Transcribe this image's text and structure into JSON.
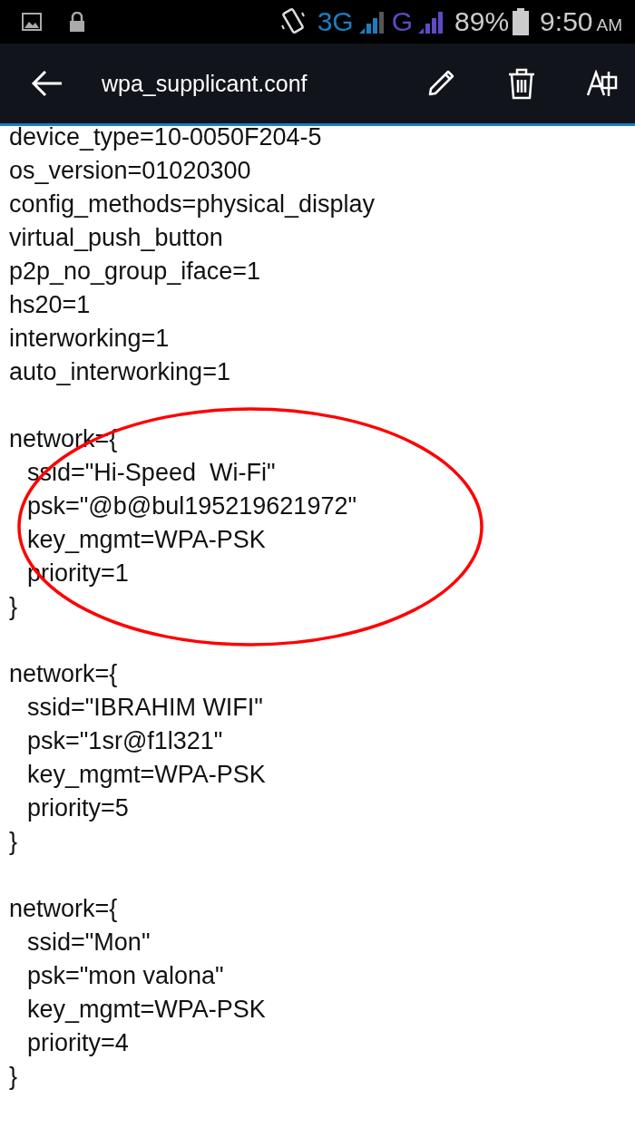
{
  "status_bar": {
    "network_1": "3G",
    "network_2": "G",
    "battery": "89%",
    "time": "9:50",
    "meridiem": "AM"
  },
  "app_bar": {
    "title": "wpa_supplicant.conf"
  },
  "settings_lines": [
    "device_type=10-0050F204-5",
    "os_version=01020300",
    "config_methods=physical_display",
    "virtual_push_button",
    "p2p_no_group_iface=1",
    "hs20=1",
    "interworking=1",
    "auto_interworking=1"
  ],
  "networks": [
    {
      "opening": "network={",
      "entries": [
        "ssid=\"Hi-Speed  Wi-Fi\"",
        "psk=\"@b@bul195219621972\"",
        "key_mgmt=WPA-PSK",
        "priority=1"
      ],
      "closing": "}",
      "circled": true
    },
    {
      "opening": "network={",
      "entries": [
        "ssid=\"IBRAHIM WIFI\"",
        "psk=\"1sr@f1l321\"",
        "key_mgmt=WPA-PSK",
        "priority=5"
      ],
      "closing": "}",
      "circled": false
    },
    {
      "opening": "network={",
      "entries": [
        "ssid=\"Mon\"",
        "psk=\"mon valona\"",
        "key_mgmt=WPA-PSK",
        "priority=4"
      ],
      "closing": "}",
      "circled": false
    }
  ]
}
